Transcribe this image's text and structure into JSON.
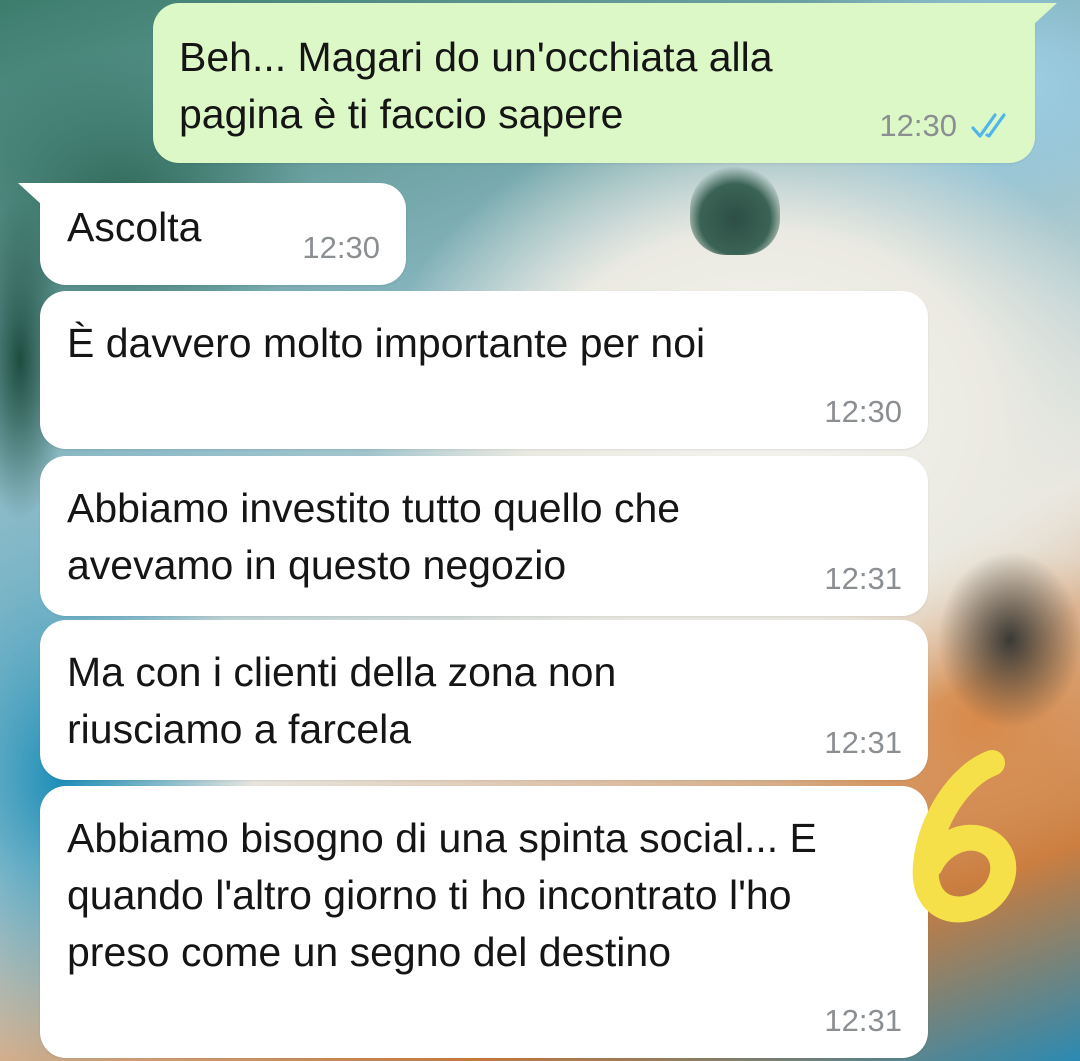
{
  "messages": [
    {
      "direction": "out",
      "text": "Beh... Magari do un'occhiata alla pagina è ti faccio sapere",
      "time": "12:30",
      "status": "read"
    },
    {
      "direction": "in",
      "text": "Ascolta",
      "time": "12:30"
    },
    {
      "direction": "in",
      "text": "È davvero molto importante per noi",
      "time": "12:30"
    },
    {
      "direction": "in",
      "text": "Abbiamo investito tutto quello che avevamo in questo negozio",
      "time": "12:31"
    },
    {
      "direction": "in",
      "text": "Ma con i clienti della zona non riusciamo a farcela",
      "time": "12:31"
    },
    {
      "direction": "in",
      "text": "Abbiamo bisogno di una spinta social... E quando l'altro giorno ti ho incontrato l'ho preso come un segno del destino",
      "time": "12:31"
    }
  ],
  "annotation": {
    "text": "6",
    "color": "#f5e04a"
  },
  "colors": {
    "outgoing_bubble": "#dcf8c6",
    "incoming_bubble": "#ffffff",
    "timestamp": "#8b8f92",
    "read_ticks": "#4fb6ec"
  },
  "icons": {
    "read_receipt": "double-check-icon"
  }
}
